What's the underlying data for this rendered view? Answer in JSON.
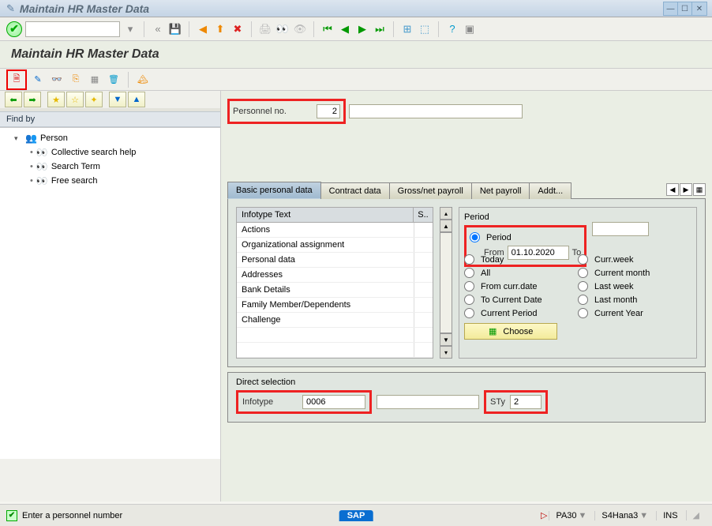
{
  "window": {
    "title": "Maintain HR Master Data"
  },
  "header2": {
    "title": "Maintain HR Master Data"
  },
  "sidebar": {
    "findby_label": "Find by",
    "nodes": [
      {
        "label": "Person"
      },
      {
        "label": "Collective search help"
      },
      {
        "label": "Search Term"
      },
      {
        "label": "Free search"
      }
    ]
  },
  "personnel": {
    "label": "Personnel no.",
    "value": "2"
  },
  "tabs": {
    "items": [
      {
        "label": "Basic personal data"
      },
      {
        "label": "Contract data"
      },
      {
        "label": "Gross/net payroll"
      },
      {
        "label": "Net payroll"
      },
      {
        "label": "Addt..."
      }
    ]
  },
  "infotype": {
    "header": "Infotype Text",
    "col2": "S..",
    "rows": [
      "Actions",
      "Organizational assignment",
      "Personal data",
      "Addresses",
      "Bank Details",
      "Family Member/Dependents",
      "Challenge"
    ]
  },
  "period": {
    "title": "Period",
    "radio_period": "Period",
    "from_label": "From",
    "from_value": "01.10.2020",
    "to_label": "To",
    "to_value": "",
    "options_left": [
      "Today",
      "All",
      "From curr.date",
      "To Current Date",
      "Current Period"
    ],
    "options_right": [
      "Curr.week",
      "Current month",
      "Last week",
      "Last month",
      "Current Year"
    ],
    "choose_label": "Choose"
  },
  "direct_sel": {
    "title": "Direct selection",
    "infotype_label": "Infotype",
    "infotype_value": "0006",
    "sty_label": "STy",
    "sty_value": "2"
  },
  "status": {
    "msg": "Enter a personnel number",
    "sap": "SAP",
    "tcode": "PA30",
    "system": "S4Hana3",
    "mode": "INS"
  }
}
